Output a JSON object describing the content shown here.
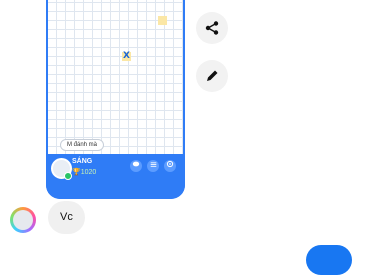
{
  "game": {
    "bubble_text": "M đánh mà",
    "player_name": "SÁNG",
    "trophy_score": "🏆1020",
    "x_mark": "X"
  },
  "message": {
    "text": "Vc"
  },
  "colors": {
    "bar": "#2f7cf6",
    "fab": "#1877f2"
  }
}
